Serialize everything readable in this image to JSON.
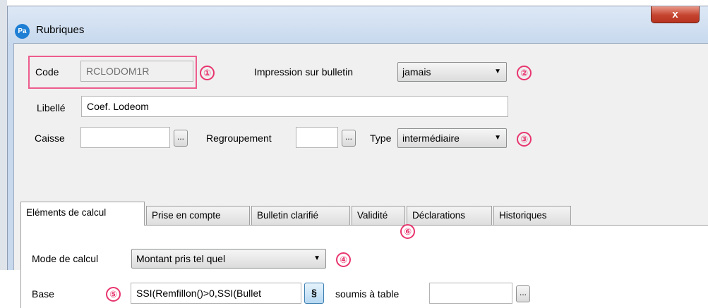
{
  "window": {
    "title": "Rubriques",
    "app_icon_text": "Pa",
    "close_label": "x"
  },
  "form": {
    "code_label": "Code",
    "code_value": "RCLODOM1R",
    "impression_label": "Impression sur bulletin",
    "impression_value": "jamais",
    "libelle_label": "Libellé",
    "libelle_value": "Coef.  Lodeom",
    "caisse_label": "Caisse",
    "caisse_value": "",
    "regroupement_label": "Regroupement",
    "regroupement_value": "",
    "type_label": "Type",
    "type_value": "intermédiaire",
    "ellipsis_label": "..."
  },
  "tabs": [
    {
      "label": "Eléments de calcul",
      "active": true
    },
    {
      "label": "Prise en compte",
      "active": false
    },
    {
      "label": "Bulletin clarifié",
      "active": false
    },
    {
      "label": "Validité",
      "active": false
    },
    {
      "label": "Déclarations",
      "active": false
    },
    {
      "label": "Historiques",
      "active": false
    }
  ],
  "calc": {
    "mode_label": "Mode de calcul",
    "mode_value": "Montant pris tel quel",
    "base_label": "Base",
    "base_value": "SSI(Remfillon()>0,SSI(Bullet",
    "section_button": "§",
    "soumis_label": "soumis à table",
    "soumis_value": ""
  },
  "annotations": [
    "①",
    "②",
    "③",
    "④",
    "⑤",
    "⑥"
  ],
  "colors": {
    "annotation": "#e8356e",
    "title_bar": "#c8d9ee",
    "close_button": "#c4432f"
  }
}
